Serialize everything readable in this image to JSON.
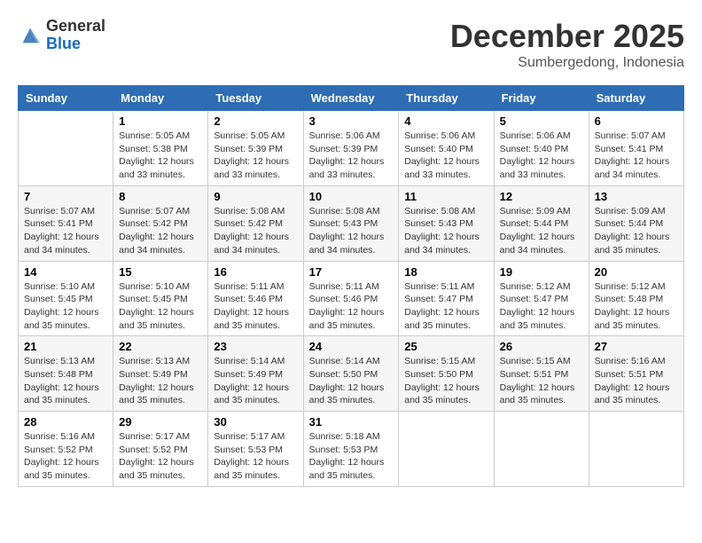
{
  "logo": {
    "general": "General",
    "blue": "Blue"
  },
  "header": {
    "month": "December 2025",
    "location": "Sumbergedong, Indonesia"
  },
  "days_of_week": [
    "Sunday",
    "Monday",
    "Tuesday",
    "Wednesday",
    "Thursday",
    "Friday",
    "Saturday"
  ],
  "weeks": [
    [
      {
        "day": "",
        "info": ""
      },
      {
        "day": "1",
        "info": "Sunrise: 5:05 AM\nSunset: 5:38 PM\nDaylight: 12 hours\nand 33 minutes."
      },
      {
        "day": "2",
        "info": "Sunrise: 5:05 AM\nSunset: 5:39 PM\nDaylight: 12 hours\nand 33 minutes."
      },
      {
        "day": "3",
        "info": "Sunrise: 5:06 AM\nSunset: 5:39 PM\nDaylight: 12 hours\nand 33 minutes."
      },
      {
        "day": "4",
        "info": "Sunrise: 5:06 AM\nSunset: 5:40 PM\nDaylight: 12 hours\nand 33 minutes."
      },
      {
        "day": "5",
        "info": "Sunrise: 5:06 AM\nSunset: 5:40 PM\nDaylight: 12 hours\nand 33 minutes."
      },
      {
        "day": "6",
        "info": "Sunrise: 5:07 AM\nSunset: 5:41 PM\nDaylight: 12 hours\nand 34 minutes."
      }
    ],
    [
      {
        "day": "7",
        "info": "Sunrise: 5:07 AM\nSunset: 5:41 PM\nDaylight: 12 hours\nand 34 minutes."
      },
      {
        "day": "8",
        "info": "Sunrise: 5:07 AM\nSunset: 5:42 PM\nDaylight: 12 hours\nand 34 minutes."
      },
      {
        "day": "9",
        "info": "Sunrise: 5:08 AM\nSunset: 5:42 PM\nDaylight: 12 hours\nand 34 minutes."
      },
      {
        "day": "10",
        "info": "Sunrise: 5:08 AM\nSunset: 5:43 PM\nDaylight: 12 hours\nand 34 minutes."
      },
      {
        "day": "11",
        "info": "Sunrise: 5:08 AM\nSunset: 5:43 PM\nDaylight: 12 hours\nand 34 minutes."
      },
      {
        "day": "12",
        "info": "Sunrise: 5:09 AM\nSunset: 5:44 PM\nDaylight: 12 hours\nand 34 minutes."
      },
      {
        "day": "13",
        "info": "Sunrise: 5:09 AM\nSunset: 5:44 PM\nDaylight: 12 hours\nand 35 minutes."
      }
    ],
    [
      {
        "day": "14",
        "info": "Sunrise: 5:10 AM\nSunset: 5:45 PM\nDaylight: 12 hours\nand 35 minutes."
      },
      {
        "day": "15",
        "info": "Sunrise: 5:10 AM\nSunset: 5:45 PM\nDaylight: 12 hours\nand 35 minutes."
      },
      {
        "day": "16",
        "info": "Sunrise: 5:11 AM\nSunset: 5:46 PM\nDaylight: 12 hours\nand 35 minutes."
      },
      {
        "day": "17",
        "info": "Sunrise: 5:11 AM\nSunset: 5:46 PM\nDaylight: 12 hours\nand 35 minutes."
      },
      {
        "day": "18",
        "info": "Sunrise: 5:11 AM\nSunset: 5:47 PM\nDaylight: 12 hours\nand 35 minutes."
      },
      {
        "day": "19",
        "info": "Sunrise: 5:12 AM\nSunset: 5:47 PM\nDaylight: 12 hours\nand 35 minutes."
      },
      {
        "day": "20",
        "info": "Sunrise: 5:12 AM\nSunset: 5:48 PM\nDaylight: 12 hours\nand 35 minutes."
      }
    ],
    [
      {
        "day": "21",
        "info": "Sunrise: 5:13 AM\nSunset: 5:48 PM\nDaylight: 12 hours\nand 35 minutes."
      },
      {
        "day": "22",
        "info": "Sunrise: 5:13 AM\nSunset: 5:49 PM\nDaylight: 12 hours\nand 35 minutes."
      },
      {
        "day": "23",
        "info": "Sunrise: 5:14 AM\nSunset: 5:49 PM\nDaylight: 12 hours\nand 35 minutes."
      },
      {
        "day": "24",
        "info": "Sunrise: 5:14 AM\nSunset: 5:50 PM\nDaylight: 12 hours\nand 35 minutes."
      },
      {
        "day": "25",
        "info": "Sunrise: 5:15 AM\nSunset: 5:50 PM\nDaylight: 12 hours\nand 35 minutes."
      },
      {
        "day": "26",
        "info": "Sunrise: 5:15 AM\nSunset: 5:51 PM\nDaylight: 12 hours\nand 35 minutes."
      },
      {
        "day": "27",
        "info": "Sunrise: 5:16 AM\nSunset: 5:51 PM\nDaylight: 12 hours\nand 35 minutes."
      }
    ],
    [
      {
        "day": "28",
        "info": "Sunrise: 5:16 AM\nSunset: 5:52 PM\nDaylight: 12 hours\nand 35 minutes."
      },
      {
        "day": "29",
        "info": "Sunrise: 5:17 AM\nSunset: 5:52 PM\nDaylight: 12 hours\nand 35 minutes."
      },
      {
        "day": "30",
        "info": "Sunrise: 5:17 AM\nSunset: 5:53 PM\nDaylight: 12 hours\nand 35 minutes."
      },
      {
        "day": "31",
        "info": "Sunrise: 5:18 AM\nSunset: 5:53 PM\nDaylight: 12 hours\nand 35 minutes."
      },
      {
        "day": "",
        "info": ""
      },
      {
        "day": "",
        "info": ""
      },
      {
        "day": "",
        "info": ""
      }
    ]
  ]
}
